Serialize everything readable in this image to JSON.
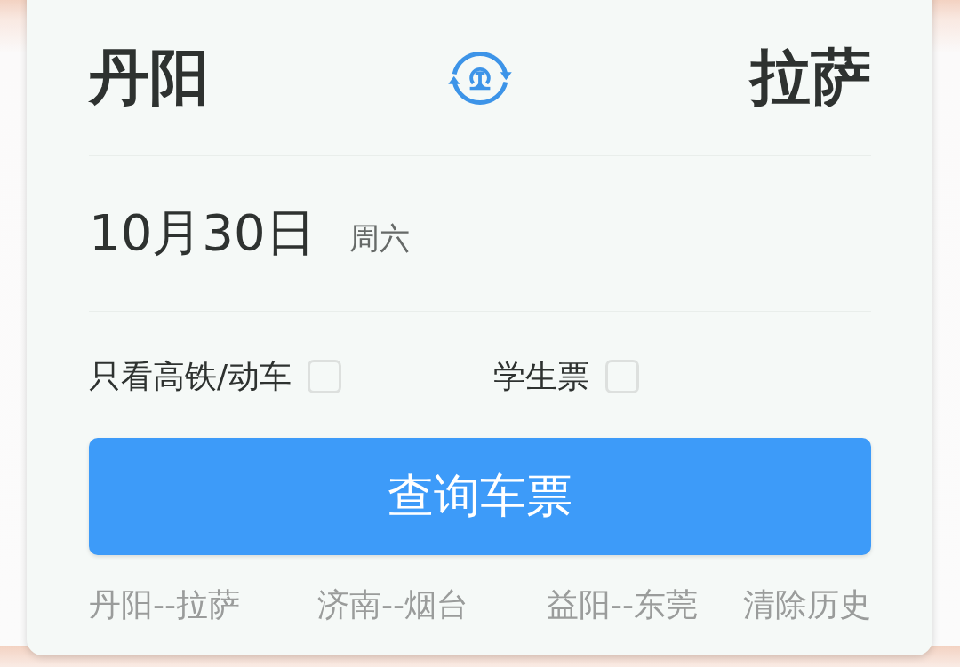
{
  "route": {
    "from": "丹阳",
    "to": "拉萨"
  },
  "date": {
    "day": "10月30日",
    "weekday": "周六"
  },
  "options": [
    {
      "label": "只看高铁/动车",
      "checked": false
    },
    {
      "label": "学生票",
      "checked": false
    }
  ],
  "search_button": "查询车票",
  "history": {
    "items": [
      "丹阳--拉萨",
      "济南--烟台",
      "益阳--东莞"
    ],
    "clear": "清除历史"
  }
}
